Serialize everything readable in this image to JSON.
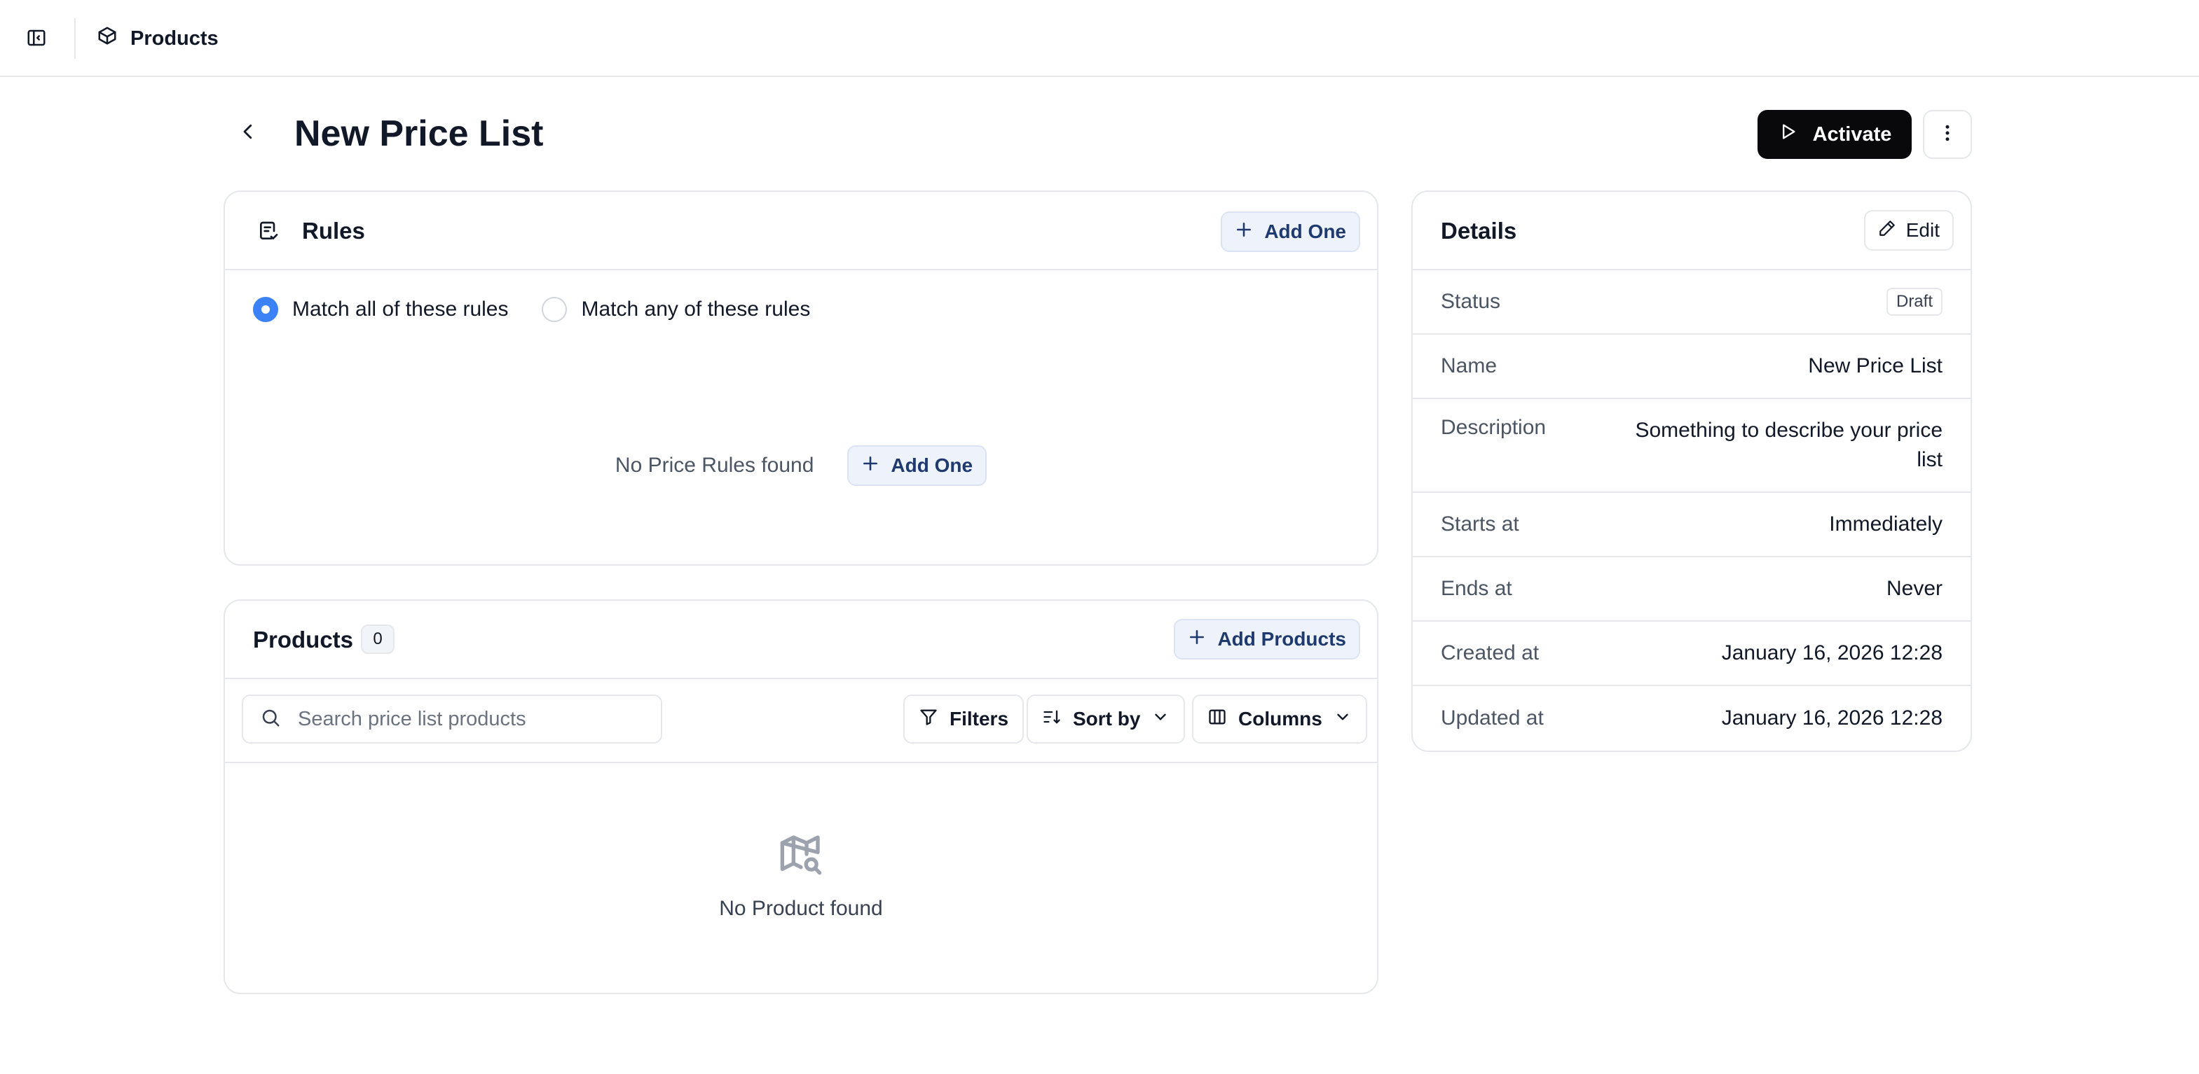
{
  "topbar": {
    "breadcrumb_label": "Products"
  },
  "header": {
    "title": "New Price List",
    "activate_label": "Activate"
  },
  "rules": {
    "title": "Rules",
    "add_label": "Add One",
    "match_all_label": "Match all of these rules",
    "match_any_label": "Match any of these rules",
    "selected": "all",
    "empty_text": "No Price Rules found",
    "empty_add_label": "Add One"
  },
  "products": {
    "title": "Products",
    "count": "0",
    "add_label": "Add Products",
    "search_placeholder": "Search price list products",
    "filters_label": "Filters",
    "sort_label": "Sort by",
    "columns_label": "Columns",
    "empty_text": "No Product found"
  },
  "details": {
    "title": "Details",
    "edit_label": "Edit",
    "rows": [
      {
        "label": "Status",
        "value": "Draft"
      },
      {
        "label": "Name",
        "value": "New Price List"
      },
      {
        "label": "Description",
        "value": "Something to describe your price list"
      },
      {
        "label": "Starts at",
        "value": "Immediately"
      },
      {
        "label": "Ends at",
        "value": "Never"
      },
      {
        "label": "Created at",
        "value": "January 16, 2026 12:28"
      },
      {
        "label": "Updated at",
        "value": "January 16, 2026 12:28"
      }
    ]
  },
  "colors": {
    "primary_button": "#09090b",
    "accent_blue": "#3b82f6",
    "chip_background": "#eef2fb",
    "chip_text": "#1e3a6e"
  }
}
